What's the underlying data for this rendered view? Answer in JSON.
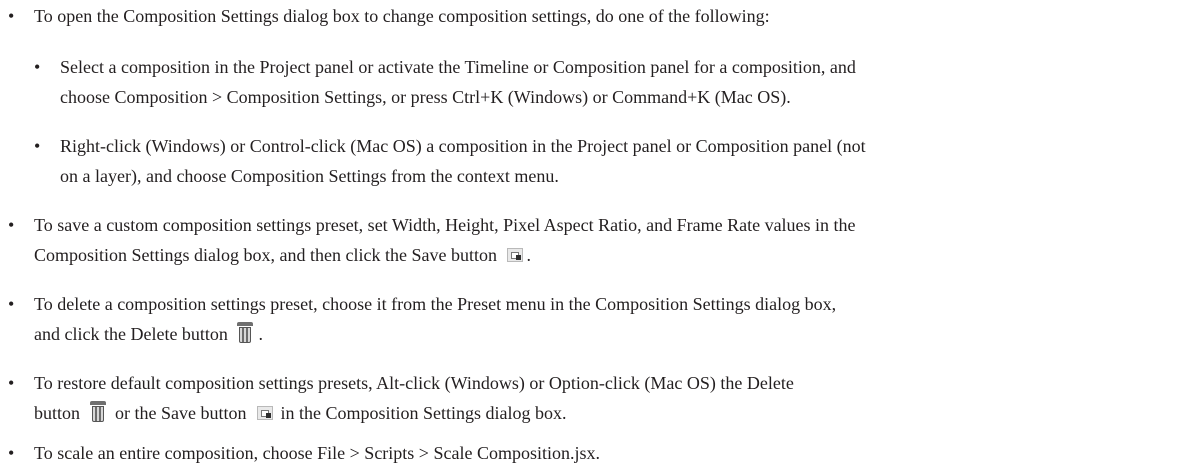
{
  "bullet_char": "•",
  "items": [
    {
      "level": 1,
      "text": "To open the Composition Settings dialog box to change composition settings, do one of the following:"
    },
    {
      "level": 2,
      "line1": "Select a composition in the Project panel or activate the Timeline or Composition panel for a composition, and",
      "line2": "choose Composition > Composition Settings, or press Ctrl+K (Windows) or Command+K (Mac OS)."
    },
    {
      "level": 2,
      "line1": "Right-click (Windows) or Control-click (Mac OS) a composition in the Project panel or Composition panel (not",
      "line2": "on a layer), and choose Composition Settings from the context menu."
    },
    {
      "level": 1,
      "line1": "To save a custom composition settings preset, set Width, Height, Pixel Aspect Ratio, and Frame Rate values in the",
      "line2_a": "Composition Settings dialog box, and then click the Save button",
      "line2_b": "."
    },
    {
      "level": 1,
      "line1": "To delete a composition settings preset, choose it from the Preset menu in the Composition Settings dialog box,",
      "line2_a": "and click the Delete button",
      "line2_b": "."
    },
    {
      "level": 1,
      "line1": "To restore default composition settings presets, Alt-click (Windows) or Option-click (Mac OS) the Delete",
      "line2_a": "button",
      "line2_b": "or the Save button",
      "line2_c": "in the Composition Settings dialog box."
    },
    {
      "level": 1,
      "text": "To scale an entire composition, choose File > Scripts > Scale Composition.jsx."
    }
  ],
  "icons": {
    "save": "save-icon",
    "delete": "trash-icon"
  }
}
